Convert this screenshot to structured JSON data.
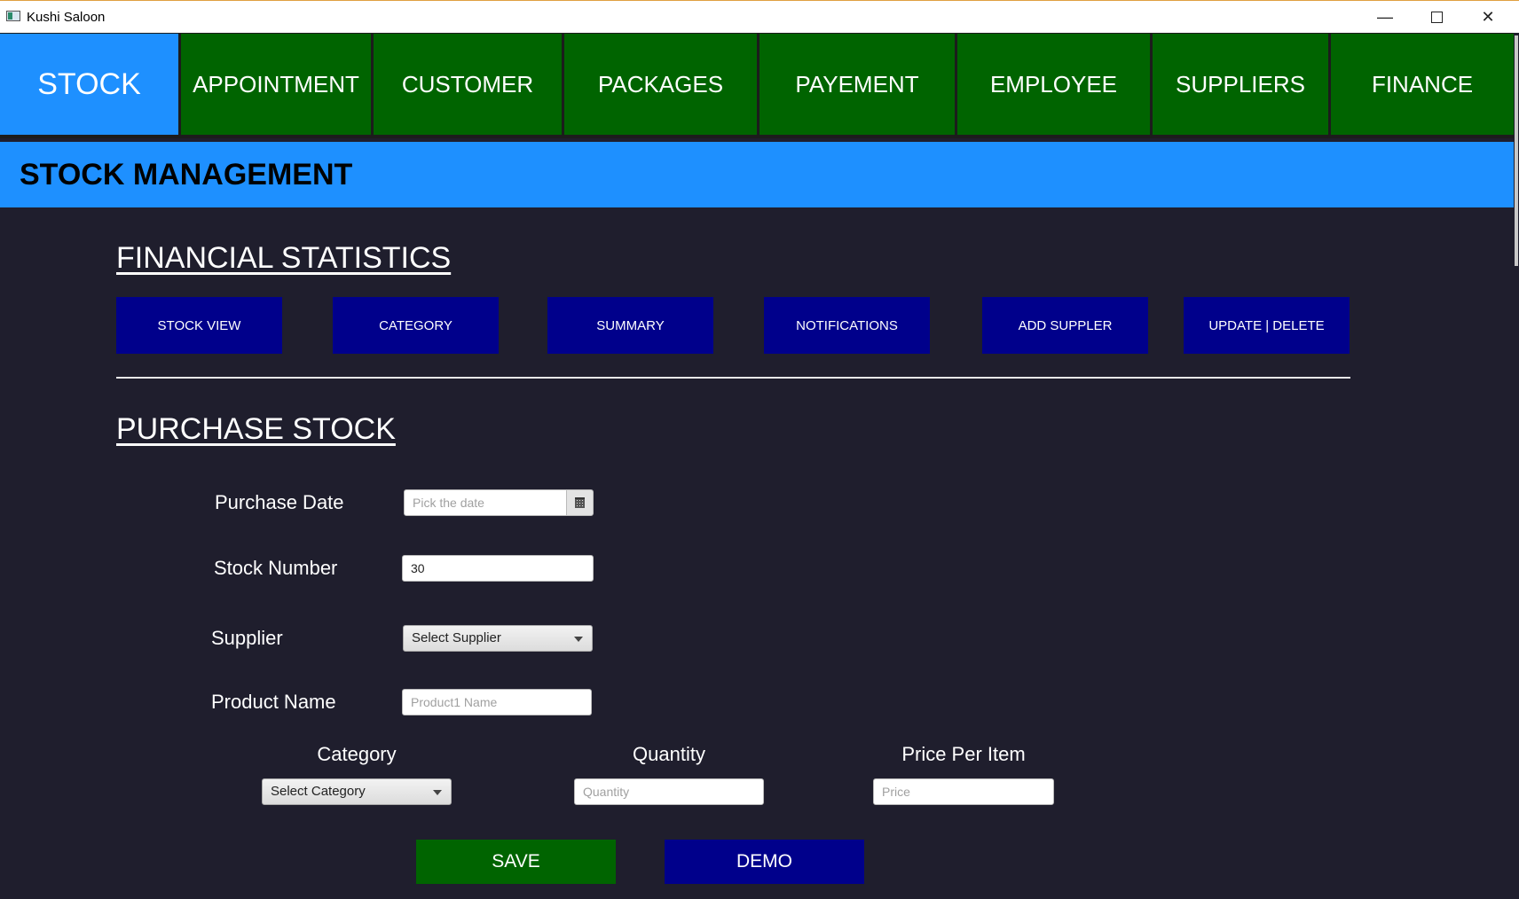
{
  "window": {
    "title": "Kushi Saloon",
    "min_glyph": "—",
    "close_glyph": "✕"
  },
  "tabs": [
    {
      "label": "STOCK",
      "active": true
    },
    {
      "label": "APPOINTMENT"
    },
    {
      "label": "CUSTOMER"
    },
    {
      "label": "PACKAGES"
    },
    {
      "label": "PAYEMENT"
    },
    {
      "label": "EMPLOYEE"
    },
    {
      "label": "SUPPLIERS"
    },
    {
      "label": "FINANCE"
    }
  ],
  "header": {
    "title": "STOCK MANAGEMENT"
  },
  "financial": {
    "heading": "FINANCIAL STATISTICS",
    "buttons": [
      "STOCK VIEW",
      "CATEGORY",
      "SUMMARY",
      "NOTIFICATIONS",
      "ADD SUPPLER",
      "UPDATE | DELETE"
    ]
  },
  "purchase": {
    "heading": "PURCHASE STOCK",
    "purchase_date_label": "Purchase Date",
    "purchase_date_placeholder": "Pick the date",
    "stock_number_label": "Stock Number",
    "stock_number_value": "30",
    "supplier_label": "Supplier",
    "supplier_selected": "Select Supplier",
    "product_name_label": "Product Name",
    "product_name_placeholder": "Product1 Name",
    "category_label": "Category",
    "category_selected": "Select Category",
    "quantity_label": "Quantity",
    "quantity_placeholder": "Quantity",
    "price_label": "Price Per Item",
    "price_placeholder": "Price"
  },
  "actions": {
    "save": "SAVE",
    "demo": "DEMO"
  },
  "colors": {
    "tab_green": "#006400",
    "active_blue": "#1e90ff",
    "button_navy": "#00008b",
    "background": "#1f1e2d"
  }
}
